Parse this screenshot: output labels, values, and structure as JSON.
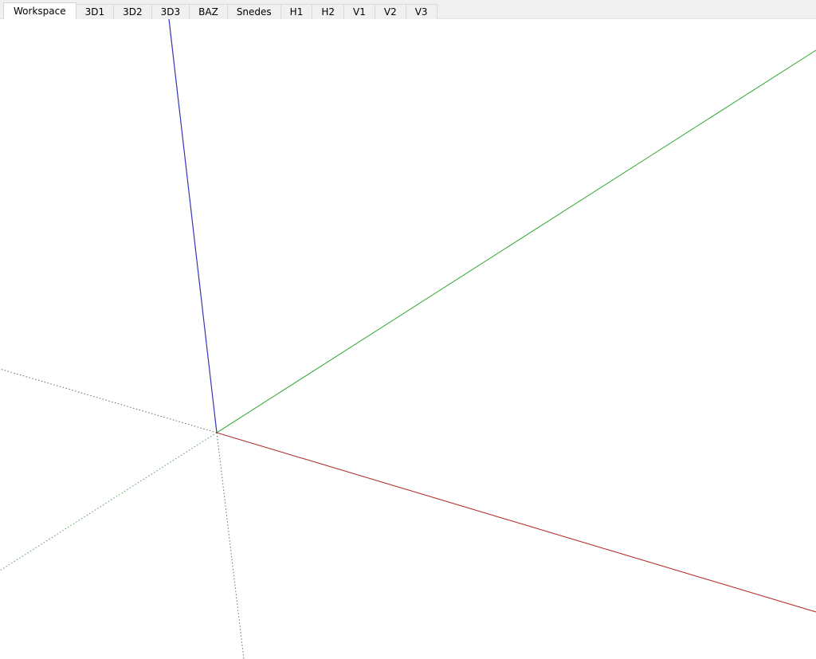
{
  "tabs": [
    {
      "label": "Workspace",
      "active": true
    },
    {
      "label": "3D1",
      "active": false
    },
    {
      "label": "3D2",
      "active": false
    },
    {
      "label": "3D3",
      "active": false
    },
    {
      "label": "BAZ",
      "active": false
    },
    {
      "label": "Snedes",
      "active": false
    },
    {
      "label": "H1",
      "active": false
    },
    {
      "label": "H2",
      "active": false
    },
    {
      "label": "V1",
      "active": false
    },
    {
      "label": "V2",
      "active": false
    },
    {
      "label": "V3",
      "active": false
    }
  ],
  "axes": {
    "x_color": "#b03030",
    "y_color": "#3fae3f",
    "z_color": "#3535b5",
    "negative_color": "#555555"
  }
}
